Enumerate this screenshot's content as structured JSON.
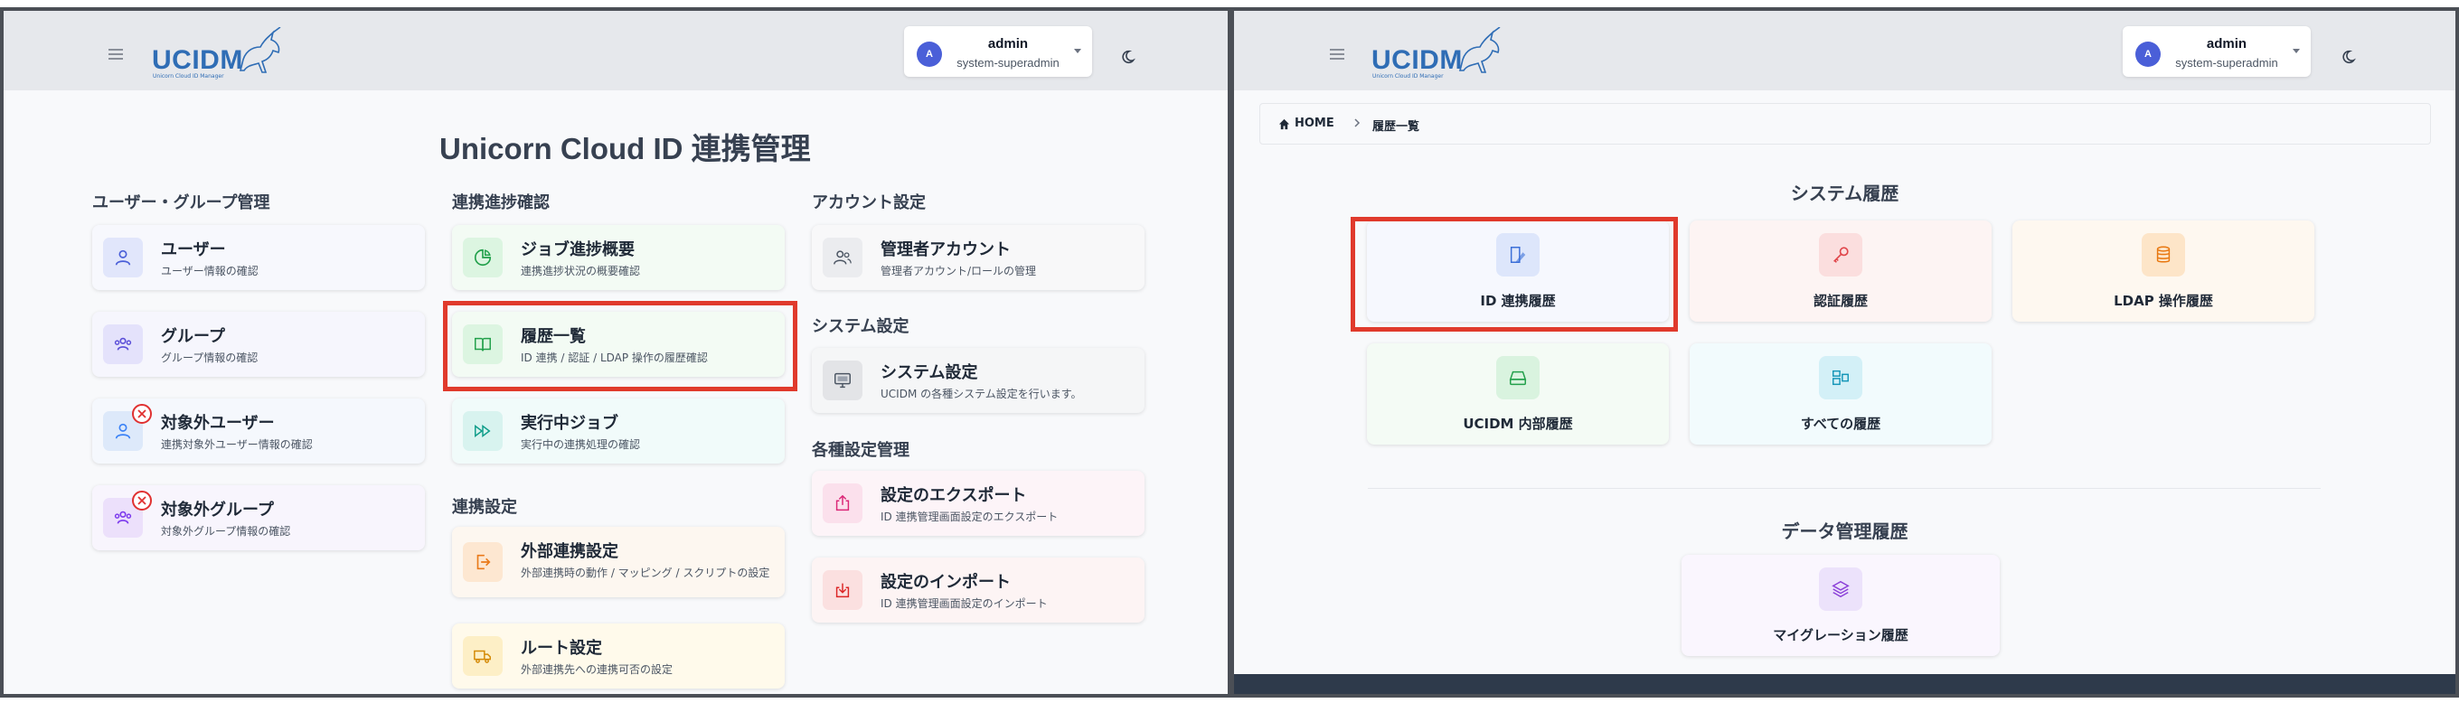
{
  "header": {
    "logo_text": "UCIDM",
    "logo_subtitle": "Unicorn Cloud ID Manager",
    "user_initial": "A",
    "user_name": "admin",
    "user_role": "system-superadmin"
  },
  "left": {
    "page_title": "Unicorn Cloud ID 連携管理",
    "columns": [
      {
        "sections": [
          {
            "heading": "ユーザー・グループ管理",
            "cards": [
              {
                "title": "ユーザー",
                "desc": "ユーザー情報の確認",
                "icon": "user-icon"
              },
              {
                "title": "グループ",
                "desc": "グループ情報の確認",
                "icon": "group-icon"
              },
              {
                "title": "対象外ユーザー",
                "desc": "連携対象外ユーザー情報の確認",
                "icon": "user-excluded-icon"
              },
              {
                "title": "対象外グループ",
                "desc": "対象外グループ情報の確認",
                "icon": "group-excluded-icon"
              }
            ]
          }
        ]
      },
      {
        "sections": [
          {
            "heading": "連携進捗確認",
            "cards": [
              {
                "title": "ジョブ進捗概要",
                "desc": "連携進捗状況の概要確認",
                "icon": "pie-chart-icon"
              },
              {
                "title": "履歴一覧",
                "desc": "ID 連携 / 認証 / LDAP 操作の履歴確認",
                "icon": "book-icon"
              },
              {
                "title": "実行中ジョブ",
                "desc": "実行中の連携処理の確認",
                "icon": "fast-forward-icon"
              }
            ]
          },
          {
            "heading": "連携設定",
            "cards": [
              {
                "title": "外部連携設定",
                "desc": "外部連携時の動作 / マッピング / スクリプトの設定",
                "icon": "external-link-icon"
              },
              {
                "title": "ルート設定",
                "desc": "外部連携先への連携可否の設定",
                "icon": "truck-icon"
              }
            ]
          }
        ]
      },
      {
        "sections": [
          {
            "heading": "アカウント設定",
            "cards": [
              {
                "title": "管理者アカウント",
                "desc": "管理者アカウント/ロールの管理",
                "icon": "admin-users-icon"
              }
            ]
          },
          {
            "heading": "システム設定",
            "cards": [
              {
                "title": "システム設定",
                "desc": "UCIDM の各種システム設定を行います。",
                "icon": "monitor-icon"
              }
            ]
          },
          {
            "heading": "各種設定管理",
            "cards": [
              {
                "title": "設定のエクスポート",
                "desc": "ID 連携管理画面設定のエクスポート",
                "icon": "export-icon"
              },
              {
                "title": "設定のインポート",
                "desc": "ID 連携管理画面設定のインポート",
                "icon": "import-icon"
              }
            ]
          }
        ]
      }
    ]
  },
  "right": {
    "breadcrumb": {
      "home": "HOME",
      "current": "履歴一覧"
    },
    "system_history": {
      "heading": "システム履歴",
      "tiles": [
        {
          "label": "ID 連携履歴",
          "icon": "id-link-icon"
        },
        {
          "label": "認証履歴",
          "icon": "key-icon"
        },
        {
          "label": "LDAP 操作履歴",
          "icon": "database-icon"
        },
        {
          "label": "UCIDM 内部履歴",
          "icon": "drive-icon"
        },
        {
          "label": "すべての履歴",
          "icon": "layout-icon"
        }
      ]
    },
    "data_history": {
      "heading": "データ管理履歴",
      "tiles": [
        {
          "label": "マイグレーション履歴",
          "icon": "layers-icon"
        }
      ]
    }
  },
  "colors": {
    "accent": "#4a5fd8",
    "highlight": "#e03a2c",
    "logo": "#2f6db5",
    "badge": "#e03131"
  }
}
